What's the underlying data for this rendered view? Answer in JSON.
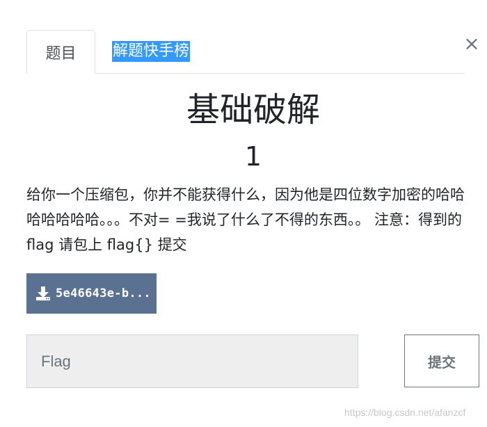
{
  "tabs": [
    {
      "label": "题目",
      "active": true
    },
    {
      "label": "解题快手榜",
      "active": false
    }
  ],
  "close_glyph": "×",
  "challenge": {
    "title": "基础破解",
    "score": "1",
    "description": "给你一个压缩包，你并不能获得什么，因为他是四位数字加密的哈哈哈哈哈哈哈。。。不对= =我说了什么了不得的东西。。 注意：得到的 flag 请包上 flag{} 提交"
  },
  "download": {
    "icon": "download-icon",
    "filename": "5e46643e-b..."
  },
  "flag_form": {
    "placeholder": "Flag",
    "value": "",
    "submit_label": "提交"
  },
  "watermark": "https://blog.csdn.net/afanzcf",
  "colors": {
    "download_bg": "#5a7192",
    "selection": "#3399ff",
    "input_bg": "#eeeeee"
  }
}
